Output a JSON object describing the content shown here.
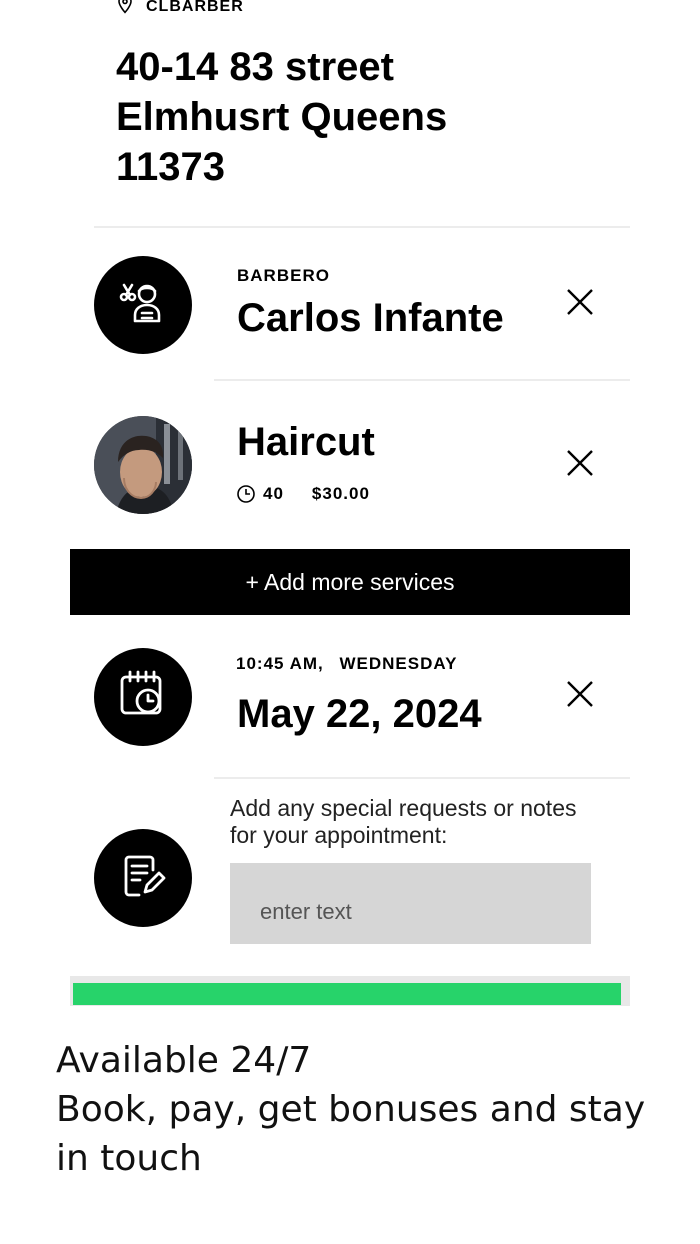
{
  "shop": {
    "name": "CLBARBER",
    "address_lines": [
      "40-14 83 street",
      "Elmhusrt Queens",
      "11373"
    ]
  },
  "barber": {
    "role_label": "BARBERO",
    "name": "Carlos Infante",
    "icon": "barber-icon"
  },
  "service": {
    "name": "Haircut",
    "duration": "40",
    "price": "$30.00",
    "photo": "client-haircut-photo"
  },
  "add_services": {
    "label": "+ Add more services"
  },
  "appointment": {
    "time": "10:45 AM,",
    "weekday": "WEDNESDAY",
    "date": "May 22, 2024",
    "icon": "calendar-clock-icon"
  },
  "notes": {
    "label": "Add any special requests or notes for your appointment:",
    "placeholder": "enter text",
    "icon": "notes-edit-icon"
  },
  "progress": {
    "fraction": 0.99,
    "color": "#27d36a"
  },
  "footer": {
    "line1": "Available 24/7",
    "line2": "Book, pay, get bonuses and stay in touch"
  }
}
